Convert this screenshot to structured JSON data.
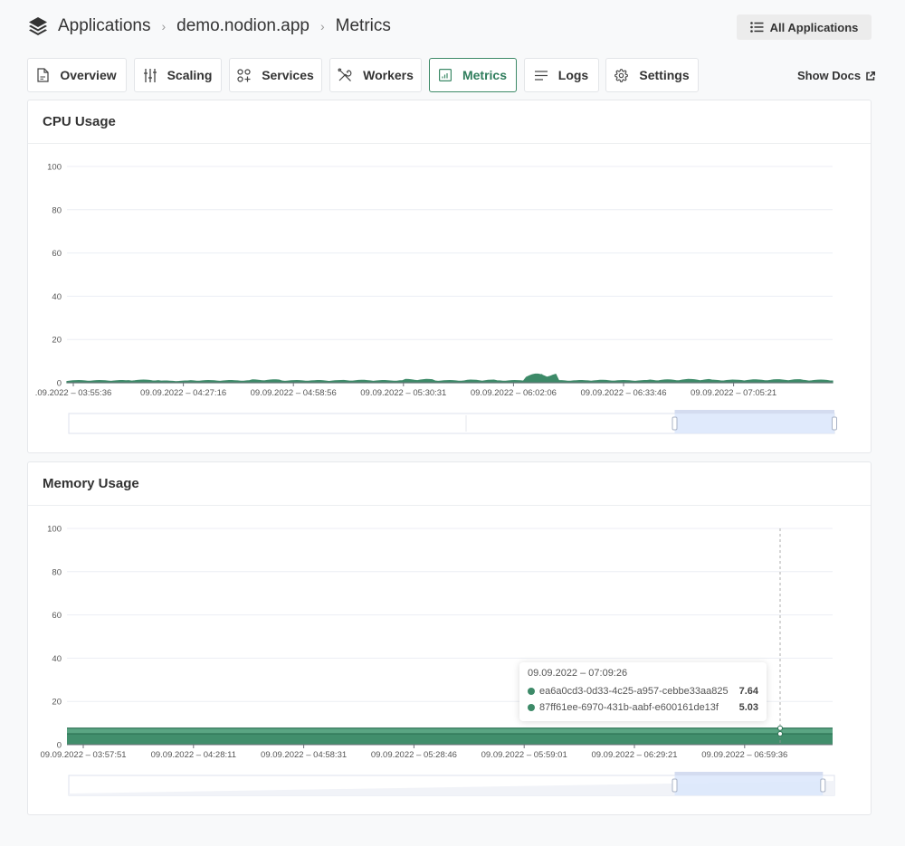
{
  "header": {
    "logo_icon": "layers-stack-icon",
    "breadcrumbs": [
      "Applications",
      "demo.nodion.app",
      "Metrics"
    ],
    "separator": "›",
    "all_applications_label": "All Applications"
  },
  "tabs": [
    {
      "label": "Overview",
      "icon": "document-icon",
      "active": false
    },
    {
      "label": "Scaling",
      "icon": "sliders-icon",
      "active": false
    },
    {
      "label": "Services",
      "icon": "services-grid-icon",
      "active": false
    },
    {
      "label": "Workers",
      "icon": "tools-icon",
      "active": false
    },
    {
      "label": "Metrics",
      "icon": "bar-chart-icon",
      "active": true
    },
    {
      "label": "Logs",
      "icon": "lines-icon",
      "active": false
    },
    {
      "label": "Settings",
      "icon": "gear-icon",
      "active": false
    }
  ],
  "show_docs_label": "Show Docs",
  "colors": {
    "accent": "#2f7d5c",
    "series_primary": "#3d8a68",
    "series_secondary": "#5aa583",
    "zoom_window": "#dbe6fb"
  },
  "cpu": {
    "title": "CPU Usage"
  },
  "memory": {
    "title": "Memory Usage",
    "tooltip": {
      "time": "09.09.2022 – 07:09:26",
      "rows": [
        {
          "name": "ea6a0cd3-0d33-4c25-a957-cebbe33aa825",
          "value": "7.64"
        },
        {
          "name": "87ff61ee-6970-431b-aabf-e600161de13f",
          "value": "5.03"
        }
      ]
    }
  },
  "chart_data": [
    {
      "type": "area",
      "title": "CPU Usage",
      "xlabel": "",
      "ylabel": "",
      "ylim": [
        0,
        100
      ],
      "yticks": [
        0,
        20,
        40,
        60,
        80,
        100
      ],
      "grid": true,
      "xticks": [
        ".09.2022 – 03:55:36",
        "09.09.2022 – 04:27:16",
        "09.09.2022 – 04:58:56",
        "09.09.2022 – 05:30:31",
        "09.09.2022 – 06:02:06",
        "09.09.2022 – 06:33:46",
        "09.09.2022 – 07:05:21"
      ],
      "series": [
        {
          "name": "cpu",
          "values_description": "near zero throughout, approx 0.5–1.5 with a spike near 06:20",
          "values": [
            1,
            1,
            1.2,
            0.8,
            1,
            1,
            1.3,
            1,
            1,
            1.1,
            1,
            1.5,
            1,
            1.2,
            1,
            4,
            1,
            1.1,
            1,
            1.3,
            1.5,
            1.2,
            1.3,
            1.4,
            1.2
          ]
        }
      ],
      "zoom_range": [
        0.75,
        1.0
      ]
    },
    {
      "type": "area",
      "title": "Memory Usage",
      "xlabel": "",
      "ylabel": "",
      "ylim": [
        0,
        100
      ],
      "yticks": [
        0,
        20,
        40,
        60,
        80,
        100
      ],
      "grid": true,
      "xticks": [
        "09.09.2022 – 03:57:51",
        "09.09.2022 – 04:28:11",
        "09.09.2022 – 04:58:31",
        "09.09.2022 – 05:28:46",
        "09.09.2022 – 05:59:01",
        "09.09.2022 – 06:29:21",
        "09.09.2022 – 06:59:36"
      ],
      "series": [
        {
          "name": "ea6a0cd3-0d33-4c25-a957-cebbe33aa825",
          "values": [
            7.6,
            7.6,
            7.6,
            7.6,
            7.6,
            7.6,
            7.6,
            7.64
          ]
        },
        {
          "name": "87ff61ee-6970-431b-aabf-e600161de13f",
          "values": [
            5.0,
            5.0,
            5.0,
            5.0,
            5.0,
            5.0,
            5.0,
            5.03
          ]
        }
      ],
      "hover_time": "09.09.2022 – 07:09:26",
      "zoom_range": [
        0.75,
        0.985
      ]
    }
  ]
}
